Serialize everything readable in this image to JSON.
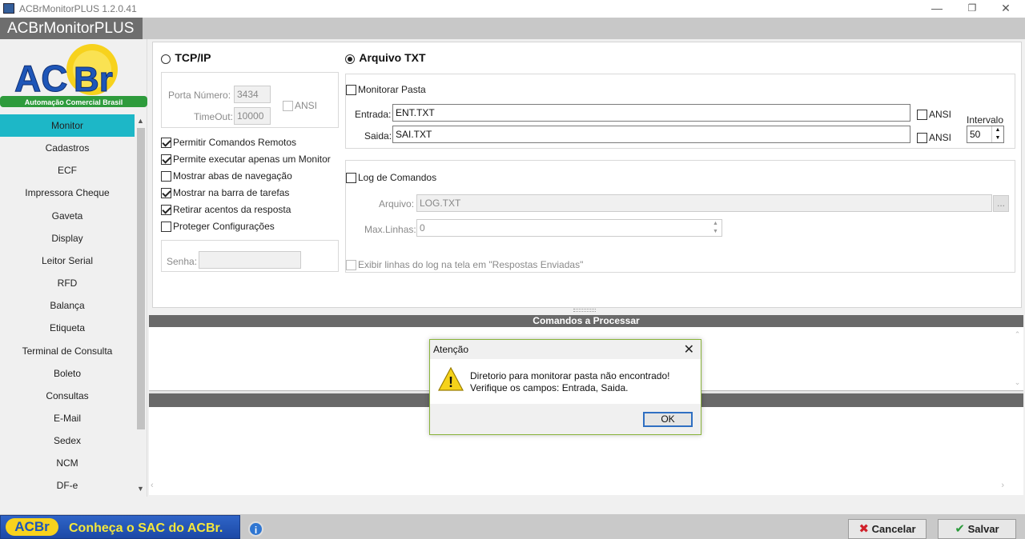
{
  "window": {
    "title": "ACBrMonitorPLUS 1.2.0.41",
    "banner": "ACBrMonitorPLUS",
    "minimize": "—",
    "restore": "❐",
    "close": "✕"
  },
  "logo": {
    "text": "ACBr",
    "tagline": "Automação Comercial Brasil"
  },
  "sidebar": {
    "items": [
      {
        "label": "Monitor",
        "active": true
      },
      {
        "label": "Cadastros"
      },
      {
        "label": "ECF"
      },
      {
        "label": "Impressora Cheque"
      },
      {
        "label": "Gaveta"
      },
      {
        "label": "Display"
      },
      {
        "label": "Leitor Serial"
      },
      {
        "label": "RFD"
      },
      {
        "label": "Balança"
      },
      {
        "label": "Etiqueta"
      },
      {
        "label": "Terminal de Consulta"
      },
      {
        "label": "Boleto"
      },
      {
        "label": "Consultas"
      },
      {
        "label": "E-Mail"
      },
      {
        "label": "Sedex"
      },
      {
        "label": "NCM"
      },
      {
        "label": "DF-e"
      }
    ]
  },
  "tcp": {
    "title": "TCP/IP",
    "selected": false,
    "port_label": "Porta Número:",
    "port_value": "3434",
    "timeout_label": "TimeOut:",
    "timeout_value": "10000",
    "ansi_label": "ANSI",
    "options": [
      {
        "label": "Permitir Comandos Remotos",
        "checked": true
      },
      {
        "label": "Permite executar apenas um Monitor",
        "checked": true
      },
      {
        "label": "Mostrar abas de navegação",
        "checked": false
      },
      {
        "label": "Mostrar na barra de tarefas",
        "checked": true
      },
      {
        "label": "Retirar acentos da resposta",
        "checked": true
      },
      {
        "label": "Proteger Configurações",
        "checked": false
      }
    ],
    "password_label": "Senha:",
    "password_value": ""
  },
  "txt": {
    "title": "Arquivo TXT",
    "selected": true,
    "monitor_folder_label": "Monitorar Pasta",
    "entrada_label": "Entrada:",
    "entrada_value": "ENT.TXT",
    "saida_label": "Saida:",
    "saida_value": "SAI.TXT",
    "ansi_label": "ANSI",
    "interval_label": "Intervalo",
    "interval_value": "50",
    "log_label": "Log de Comandos",
    "arquivo_label": "Arquivo:",
    "arquivo_value": "LOG.TXT",
    "browse_label": "...",
    "maxlines_label": "Max.Linhas:",
    "maxlines_value": "0",
    "show_log_label": "Exibir linhas do log na tela em \"Respostas Enviadas\""
  },
  "commands": {
    "header": "Comandos a Processar"
  },
  "footer": {
    "sac_logo": "ACBr",
    "sac_text": "Conheça o SAC do ACBr.",
    "info": "i",
    "cancel_label": "Cancelar",
    "save_label": "Salvar"
  },
  "dialog": {
    "title": "Atenção",
    "line1": "Diretorio para monitorar pasta não encontrado!",
    "line2": "Verifique os campos: Entrada, Saida.",
    "ok_label": "OK",
    "close": "✕",
    "warning": "!"
  }
}
